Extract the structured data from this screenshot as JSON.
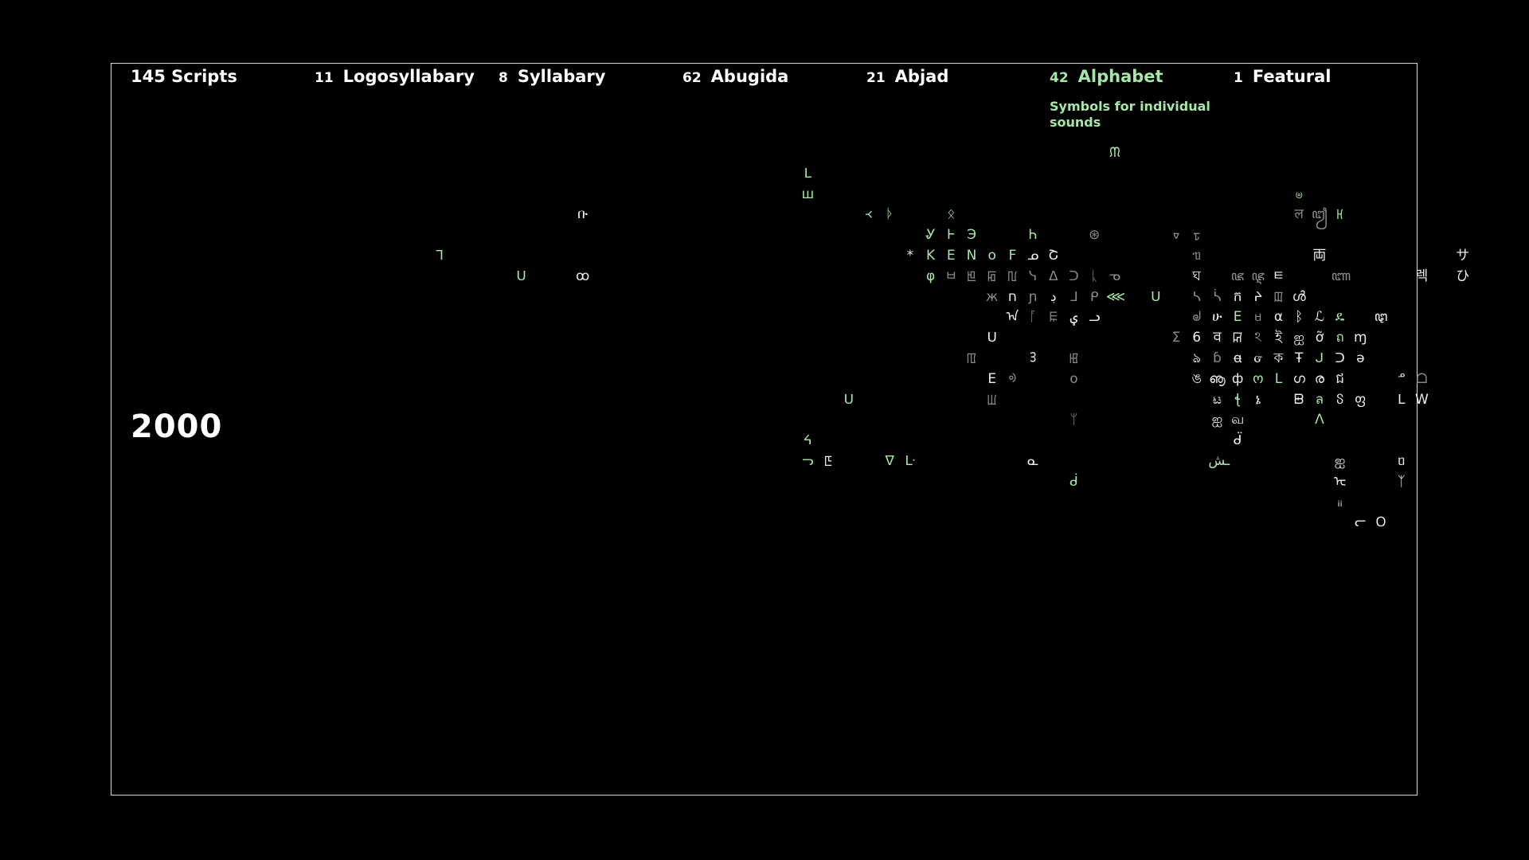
{
  "header": {
    "scripts": {
      "count": "145",
      "label": "Scripts"
    },
    "categories": [
      {
        "count": "11",
        "label": "Logosyllabary"
      },
      {
        "count": "8",
        "label": "Syllabary"
      },
      {
        "count": "62",
        "label": "Abugida"
      },
      {
        "count": "21",
        "label": "Abjad"
      },
      {
        "count": "42",
        "label": "Alphabet"
      },
      {
        "count": "1",
        "label": "Featural"
      }
    ],
    "highlight_subtitle": "Symbols for individual sounds"
  },
  "year": "2000",
  "colors": {
    "background": "#000000",
    "frame": "#d8d8d8",
    "text": "#ffffff",
    "highlight": "#a6e6a6"
  },
  "glyphs": [
    {
      "ch": "ቡ",
      "c": "w",
      "col": 21,
      "row": 3
    },
    {
      "ch": "ᒣ",
      "c": "gr",
      "col": 14,
      "row": 5
    },
    {
      "ch": "ᑌ",
      "c": "gr",
      "col": 18,
      "row": 6
    },
    {
      "ch": "ꝏ",
      "c": "w",
      "col": 21,
      "row": 6
    },
    {
      "ch": "ᒪ",
      "c": "gr",
      "col": 32,
      "row": 1
    },
    {
      "ch": "ш",
      "c": "gr",
      "col": 32,
      "row": 2
    },
    {
      "ch": "᚜",
      "c": "gr",
      "col": 35,
      "row": 3
    },
    {
      "ch": "ᚦ",
      "c": "gr",
      "col": 36,
      "row": 3
    },
    {
      "ch": "ᛟ",
      "c": "gr",
      "col": 39,
      "row": 3
    },
    {
      "ch": "Ꮍ",
      "c": "gr",
      "col": 38,
      "row": 4
    },
    {
      "ch": "Ꮀ",
      "c": "gr",
      "col": 39,
      "row": 4
    },
    {
      "ch": "Э",
      "c": "gr",
      "col": 40,
      "row": 4
    },
    {
      "ch": "Ꮒ",
      "c": "gr",
      "col": 43,
      "row": 4
    },
    {
      "ch": "*",
      "c": "w",
      "col": 37,
      "row": 5
    },
    {
      "ch": "K",
      "c": "gr",
      "col": 38,
      "row": 5
    },
    {
      "ch": "E",
      "c": "gr",
      "col": 39,
      "row": 5
    },
    {
      "ch": "N",
      "c": "gr",
      "col": 40,
      "row": 5
    },
    {
      "ch": "o",
      "c": "gr",
      "col": 41,
      "row": 5
    },
    {
      "ch": "F",
      "c": "gr",
      "col": 42,
      "row": 5
    },
    {
      "ch": "ᓄ",
      "c": "w",
      "col": 43,
      "row": 5
    },
    {
      "ch": "Շ",
      "c": "w",
      "col": 44,
      "row": 5
    },
    {
      "ch": "φ",
      "c": "gr",
      "col": 38,
      "row": 6
    },
    {
      "ch": "ㅂ",
      "c": "dim",
      "col": 39,
      "row": 6
    },
    {
      "ch": "ꡁ",
      "c": "dim",
      "col": 40,
      "row": 6
    },
    {
      "ch": "ꡂ",
      "c": "dim",
      "col": 41,
      "row": 6
    },
    {
      "ch": "ꡃ",
      "c": "dim",
      "col": 42,
      "row": 6
    },
    {
      "ch": "ᓭ",
      "c": "dim",
      "col": 43,
      "row": 6
    },
    {
      "ch": "ᐃ",
      "c": "dim",
      "col": 44,
      "row": 6
    },
    {
      "ch": "ᑐ",
      "c": "dim",
      "col": 45,
      "row": 6
    },
    {
      "ch": "ᚳ",
      "c": "dim",
      "col": 46,
      "row": 6
    },
    {
      "ch": "ᓀ",
      "c": "dim",
      "col": 47,
      "row": 6
    },
    {
      "ch": "ᙏ",
      "c": "gr",
      "col": 47,
      "row": 0
    },
    {
      "ch": "⊛",
      "c": "dim",
      "col": 46,
      "row": 4
    },
    {
      "ch": "ᢦ",
      "c": "dim",
      "col": 50,
      "row": 4
    },
    {
      "ch": "ᢧ",
      "c": "dim",
      "col": 51,
      "row": 4
    },
    {
      "ch": "ж",
      "c": "dim",
      "col": 41,
      "row": 7
    },
    {
      "ch": "ח",
      "c": "w",
      "col": 42,
      "row": 7
    },
    {
      "ch": "ɲ",
      "c": "dim",
      "col": 43,
      "row": 7
    },
    {
      "ch": "ڊ",
      "c": "w",
      "col": 44,
      "row": 7
    },
    {
      "ch": "ᒧ",
      "c": "dim",
      "col": 45,
      "row": 7
    },
    {
      "ch": "ᑭ",
      "c": "dim",
      "col": 46,
      "row": 7
    },
    {
      "ch": "⋘",
      "c": "gr",
      "col": 47,
      "row": 7
    },
    {
      "ch": "ᑌ",
      "c": "gr",
      "col": 49,
      "row": 7
    },
    {
      "ch": "ᠠ",
      "c": "w",
      "col": 42,
      "row": 8
    },
    {
      "ch": "ᚪ",
      "c": "dim",
      "col": 43,
      "row": 8
    },
    {
      "ch": "ꡀ",
      "c": "dim",
      "col": 44,
      "row": 8
    },
    {
      "ch": "ؠ",
      "c": "w",
      "col": 45,
      "row": 8
    },
    {
      "ch": "ᓗ",
      "c": "w",
      "col": 46,
      "row": 8
    },
    {
      "ch": "ᑌ",
      "c": "w",
      "col": 41,
      "row": 9
    },
    {
      "ch": "ꡄ",
      "c": "dim",
      "col": 40,
      "row": 10
    },
    {
      "ch": "ᢃ",
      "c": "w",
      "col": 43,
      "row": 10
    },
    {
      "ch": "ꡅ",
      "c": "dim",
      "col": 45,
      "row": 10
    },
    {
      "ch": "E",
      "c": "w",
      "col": 41,
      "row": 11
    },
    {
      "ch": "ᢀ",
      "c": "dim",
      "col": 42,
      "row": 11
    },
    {
      "ch": "o",
      "c": "dim",
      "col": 45,
      "row": 11
    },
    {
      "ch": "ᑌ",
      "c": "gr",
      "col": 34,
      "row": 12
    },
    {
      "ch": "ꡆ",
      "c": "dim",
      "col": 41,
      "row": 12
    },
    {
      "ch": "ᛘ",
      "c": "dim",
      "col": 45,
      "row": 13
    },
    {
      "ch": "ᔦ",
      "c": "gr",
      "col": 32,
      "row": 14
    },
    {
      "ch": "ᓓ",
      "c": "gr",
      "col": 32,
      "row": 15
    },
    {
      "ch": "ꡇ",
      "c": "w",
      "col": 33,
      "row": 15
    },
    {
      "ch": "ᐁ",
      "c": "gr",
      "col": 36,
      "row": 15
    },
    {
      "ch": "ᒷ",
      "c": "gr",
      "col": 37,
      "row": 15
    },
    {
      "ch": "ᓇ",
      "c": "w",
      "col": 43,
      "row": 15
    },
    {
      "ch": "ᑰ",
      "c": "gr",
      "col": 45,
      "row": 16
    },
    {
      "ch": "ၑ",
      "c": "gr",
      "col": 56,
      "row": 2
    },
    {
      "ch": "ल",
      "c": "dim",
      "col": 56,
      "row": 3
    },
    {
      "ch": "ꦙ",
      "c": "dim",
      "col": 57,
      "row": 3
    },
    {
      "ch": "ꡘ",
      "c": "gr",
      "col": 58,
      "row": 3
    },
    {
      "ch": "両",
      "c": "w",
      "col": 57,
      "row": 5
    },
    {
      "ch": "ᥓ",
      "c": "dim",
      "col": 51,
      "row": 5
    },
    {
      "ch": "ঘ",
      "c": "w",
      "col": 51,
      "row": 6
    },
    {
      "ch": "ꦗ",
      "c": "dim",
      "col": 53,
      "row": 6
    },
    {
      "ch": "ꦘ",
      "c": "dim",
      "col": 54,
      "row": 6
    },
    {
      "ch": "ㅌ",
      "c": "w",
      "col": 55,
      "row": 6
    },
    {
      "ch": "ꦚ",
      "c": "dim",
      "col": 58,
      "row": 6
    },
    {
      "ch": "ᓴ",
      "c": "dim",
      "col": 51,
      "row": 7
    },
    {
      "ch": "ᓵ",
      "c": "dim",
      "col": 52,
      "row": 7
    },
    {
      "ch": "ក",
      "c": "w",
      "col": 53,
      "row": 7
    },
    {
      "ch": "ᔨ",
      "c": "w",
      "col": 54,
      "row": 7
    },
    {
      "ch": "ꡉ",
      "c": "dim",
      "col": 55,
      "row": 7
    },
    {
      "ch": "ൾ",
      "c": "w",
      "col": 56,
      "row": 7
    },
    {
      "ch": "ᖙ",
      "c": "dim",
      "col": 51,
      "row": 8
    },
    {
      "ch": "ሁ",
      "c": "w",
      "col": 52,
      "row": 8
    },
    {
      "ch": "E",
      "c": "gr",
      "col": 53,
      "row": 8
    },
    {
      "ch": "ᥛ",
      "c": "dim",
      "col": 54,
      "row": 8
    },
    {
      "ch": "α",
      "c": "w",
      "col": 55,
      "row": 8
    },
    {
      "ch": "ᛒ",
      "c": "w",
      "col": 56,
      "row": 8
    },
    {
      "ch": "ℒ",
      "c": "w",
      "col": 57,
      "row": 8
    },
    {
      "ch": "ዴ",
      "c": "gr",
      "col": 58,
      "row": 8
    },
    {
      "ch": "ꦛ",
      "c": "w",
      "col": 60,
      "row": 8
    },
    {
      "ch": "Σ",
      "c": "dim",
      "col": 50,
      "row": 9
    },
    {
      "ch": "6",
      "c": "w",
      "col": 51,
      "row": 9
    },
    {
      "ch": "ꠛ",
      "c": "w",
      "col": 52,
      "row": 9
    },
    {
      "ch": "ꡒ",
      "c": "w",
      "col": 53,
      "row": 9
    },
    {
      "ch": "ঽ",
      "c": "dim",
      "col": 54,
      "row": 9
    },
    {
      "ch": "ই",
      "c": "w",
      "col": 55,
      "row": 9
    },
    {
      "ch": "ஐ",
      "c": "w",
      "col": 56,
      "row": 9
    },
    {
      "ch": "ỡ",
      "c": "w",
      "col": 57,
      "row": 9
    },
    {
      "ch": "ถ",
      "c": "gr",
      "col": 58,
      "row": 9
    },
    {
      "ch": "ɱ",
      "c": "w",
      "col": 59,
      "row": 9
    },
    {
      "ch": "ঌ",
      "c": "w",
      "col": 51,
      "row": 10
    },
    {
      "ch": "ɓ",
      "c": "dim",
      "col": 52,
      "row": 10
    },
    {
      "ch": "ꬰ",
      "c": "w",
      "col": 53,
      "row": 10
    },
    {
      "ch": "ᏻ",
      "c": "w",
      "col": 54,
      "row": 10
    },
    {
      "ch": "ক",
      "c": "w",
      "col": 55,
      "row": 10
    },
    {
      "ch": "Ŧ",
      "c": "w",
      "col": 56,
      "row": 10
    },
    {
      "ch": "ᒍ",
      "c": "gr",
      "col": 57,
      "row": 10
    },
    {
      "ch": "ᑐ",
      "c": "w",
      "col": 58,
      "row": 10
    },
    {
      "ch": "ə",
      "c": "w",
      "col": 59,
      "row": 10
    },
    {
      "ch": "ঙ",
      "c": "w",
      "col": 51,
      "row": 11
    },
    {
      "ch": "ൡ",
      "c": "w",
      "col": 52,
      "row": 11
    },
    {
      "ch": "ф",
      "c": "w",
      "col": 53,
      "row": 11
    },
    {
      "ch": "ო",
      "c": "gr",
      "col": 54,
      "row": 11
    },
    {
      "ch": "L",
      "c": "gr",
      "col": 55,
      "row": 11
    },
    {
      "ch": "ഗ",
      "c": "w",
      "col": 56,
      "row": 11
    },
    {
      "ch": "ര",
      "c": "w",
      "col": 57,
      "row": 11
    },
    {
      "ch": "ជ",
      "c": "w",
      "col": 58,
      "row": 11
    },
    {
      "ch": "ᓒ",
      "c": "w",
      "col": 61,
      "row": 11
    },
    {
      "ch": "ᗝ",
      "c": "dim",
      "col": 62,
      "row": 11
    },
    {
      "ch": "ಟ",
      "c": "w",
      "col": 52,
      "row": 12
    },
    {
      "ch": "ꞎ",
      "c": "gr",
      "col": 53,
      "row": 12
    },
    {
      "ch": "ኔ",
      "c": "w",
      "col": 54,
      "row": 12
    },
    {
      "ch": "ᗸ",
      "c": "w",
      "col": 56,
      "row": 12
    },
    {
      "ch": "ล",
      "c": "gr",
      "col": 57,
      "row": 12
    },
    {
      "ch": "ჽ",
      "c": "w",
      "col": 58,
      "row": 12
    },
    {
      "ch": "ფ",
      "c": "w",
      "col": 59,
      "row": 12
    },
    {
      "ch": "ᒪ",
      "c": "w",
      "col": 61,
      "row": 12
    },
    {
      "ch": "W",
      "c": "w",
      "col": 62,
      "row": 12
    },
    {
      "ch": "ஐ",
      "c": "w",
      "col": 52,
      "row": 13
    },
    {
      "ch": "வ",
      "c": "w",
      "col": 53,
      "row": 13
    },
    {
      "ch": "Λ",
      "c": "gr",
      "col": 57,
      "row": 13
    },
    {
      "ch": "ᑱ",
      "c": "w",
      "col": 53,
      "row": 14
    },
    {
      "ch": "ـش",
      "c": "gr",
      "col": 52,
      "row": 15
    },
    {
      "ch": "ஐ",
      "c": "w",
      "col": 58,
      "row": 15
    },
    {
      "ch": "ᥝ",
      "c": "w",
      "col": 61,
      "row": 15
    },
    {
      "ch": "ᡄ",
      "c": "w",
      "col": 58,
      "row": 16
    },
    {
      "ch": "ᛉ",
      "c": "w",
      "col": 61,
      "row": 16
    },
    {
      "ch": "ᵢᵢ",
      "c": "w",
      "col": 58,
      "row": 17
    },
    {
      "ch": "ᓕ",
      "c": "w",
      "col": 59,
      "row": 18
    },
    {
      "ch": "ᱛ",
      "c": "w",
      "col": 60,
      "row": 18
    },
    {
      "ch": "サ",
      "c": "w",
      "col": 64,
      "row": 5
    },
    {
      "ch": "렉",
      "c": "w",
      "col": 62,
      "row": 6
    },
    {
      "ch": "ひ",
      "c": "w",
      "col": 64,
      "row": 6
    }
  ]
}
